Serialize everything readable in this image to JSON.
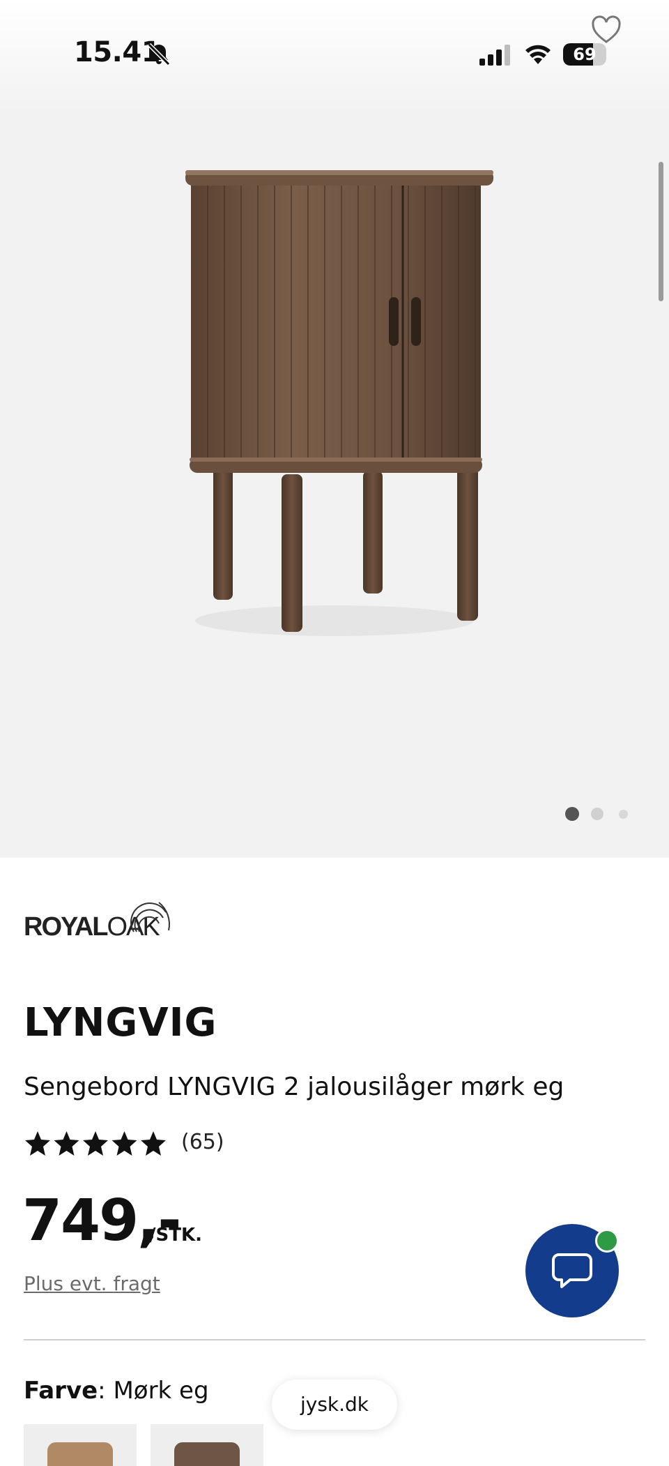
{
  "status_bar": {
    "time": "15.41",
    "battery": "69",
    "battery_level": 0.69
  },
  "gallery": {
    "image_count": 3,
    "active_index": 1
  },
  "product": {
    "brand": "ROYALOAK",
    "brand_bold": "ROYAL",
    "brand_light": "OAK",
    "title": "LYNGVIG",
    "subtitle": "Sengebord LYNGVIG 2 jalousilåger mørk eg",
    "rating": 5,
    "review_count": "(65)",
    "price": "749,-",
    "unit": "/STK.",
    "freight": "Plus evt. fragt",
    "color_label": "Farve",
    "color_sep": ": ",
    "color_value": "Mørk eg"
  },
  "browser": {
    "url": "jysk.dk"
  },
  "colors": {
    "chat_button": "#143c8c",
    "online_dot": "#2e9a45",
    "wood": "#6b5140"
  },
  "icons": [
    "bell-slash-icon",
    "signal-icon",
    "wifi-icon",
    "battery-icon",
    "heart-icon",
    "star-icon",
    "chat-icon"
  ]
}
